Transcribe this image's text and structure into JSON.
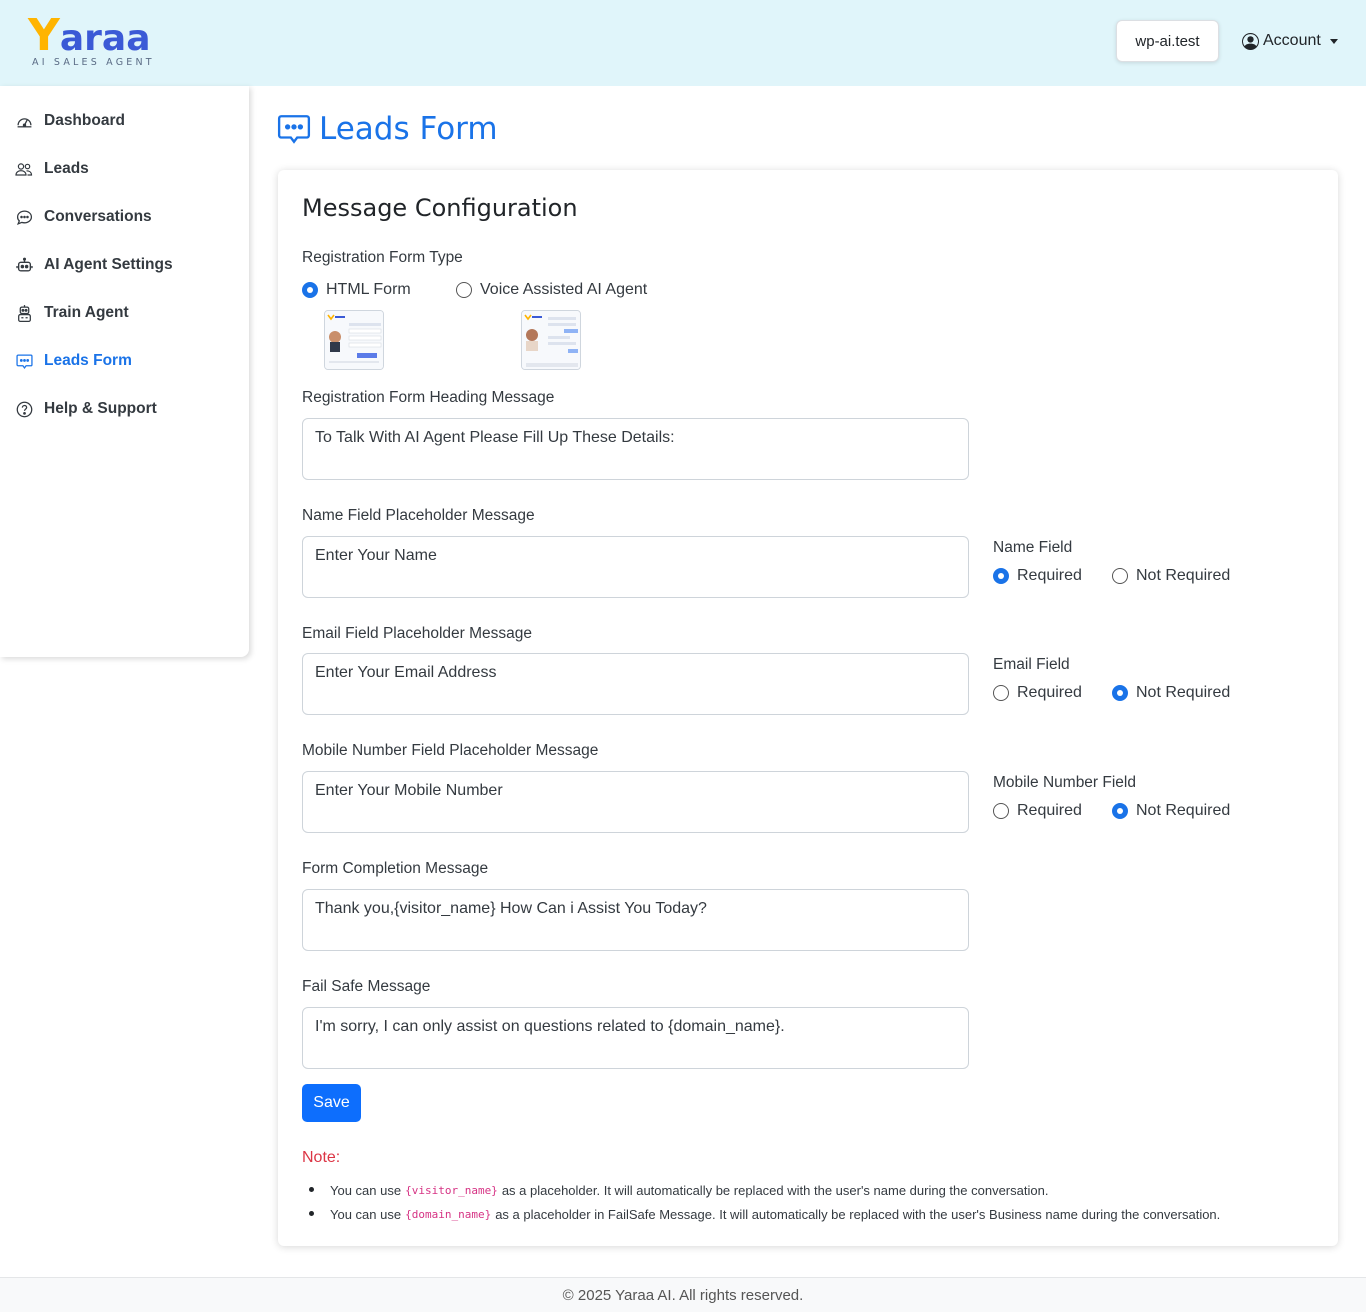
{
  "header": {
    "logo_main": "araa",
    "logo_letter": "Y",
    "logo_tagline": "AI SALES AGENT",
    "domain": "wp-ai.test",
    "account_label": "Account"
  },
  "sidebar": {
    "items": [
      {
        "label": "Dashboard",
        "icon": "speedometer-icon"
      },
      {
        "label": "Leads",
        "icon": "people-icon"
      },
      {
        "label": "Conversations",
        "icon": "chat-dots-icon"
      },
      {
        "label": "AI Agent Settings",
        "icon": "robot-icon"
      },
      {
        "label": "Train Agent",
        "icon": "train-agent-icon"
      },
      {
        "label": "Leads Form",
        "icon": "chat-square-dots-icon",
        "active": true
      },
      {
        "label": "Help & Support",
        "icon": "question-circle-icon"
      }
    ]
  },
  "page": {
    "title": "Leads Form"
  },
  "config": {
    "card_title": "Message Configuration",
    "form_type": {
      "label": "Registration Form Type",
      "options": [
        "HTML Form",
        "Voice Assisted AI Agent"
      ],
      "selected": "HTML Form"
    },
    "heading_msg": {
      "label": "Registration Form Heading Message",
      "value": "To Talk With AI Agent Please Fill Up These Details:"
    },
    "name_field": {
      "label": "Name Field Placeholder Message",
      "value": "Enter Your Name",
      "req_label": "Name Field",
      "selected": "Required"
    },
    "email_field": {
      "label": "Email Field Placeholder Message",
      "value": "Enter Your Email Address",
      "req_label": "Email Field",
      "selected": "Not Required"
    },
    "mobile_field": {
      "label": "Mobile Number Field Placeholder Message",
      "value": "Enter Your Mobile Number",
      "req_label": "Mobile Number Field",
      "selected": "Not Required"
    },
    "completion_msg": {
      "label": "Form Completion Message",
      "value": "Thank you,{visitor_name} How Can i Assist You Today?"
    },
    "failsafe_msg": {
      "label": "Fail Safe Message",
      "value": "I'm sorry, I can only assist on questions related to {domain_name}."
    },
    "req_options": [
      "Required",
      "Not Required"
    ],
    "save_label": "Save"
  },
  "note": {
    "title": "Note:",
    "items": [
      {
        "before": "You can use",
        "code": "{visitor_name}",
        "after": "as a placeholder. It will automatically be replaced with the user's name during the conversation."
      },
      {
        "before": "You can use",
        "code": "{domain_name}",
        "after": "as a placeholder in FailSafe Message. It will automatically be replaced with the user's Business name during the conversation."
      }
    ]
  },
  "footer": {
    "text": "© 2025 Yaraa AI. All rights reserved."
  },
  "colors": {
    "accent": "#1a73e8",
    "header_bg": "#e0f5fa",
    "save_button": "#0d6efd",
    "note_red": "#dc3545"
  }
}
